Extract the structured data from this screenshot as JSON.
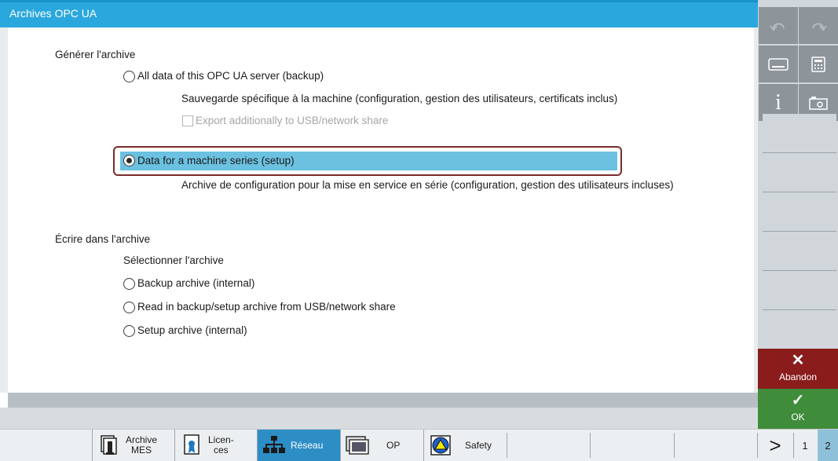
{
  "window": {
    "title": "Archives OPC UA"
  },
  "generate": {
    "heading": "Générer l'archive",
    "option_backup": {
      "label": "All data of this OPC UA server (backup)",
      "description": "Sauvegarde spécifique à la machine (configuration, gestion des utilisateurs, certificats inclus)",
      "selected": false
    },
    "export_checkbox": {
      "label": "Export additionally to USB/network share",
      "checked": false,
      "enabled": false
    },
    "option_setup": {
      "label": "Data for a machine series (setup)",
      "description": "Archive de configuration pour la mise en service en série (configuration, gestion des utilisateurs incluses)",
      "selected": true
    }
  },
  "write": {
    "heading": "Écrire dans l'archive",
    "subheading": "Sélectionner l'archive",
    "options": [
      {
        "label": "Backup archive (internal)",
        "selected": false
      },
      {
        "label": "Read in backup/setup archive from USB/network share",
        "selected": false
      },
      {
        "label": "Setup archive (internal)",
        "selected": false
      }
    ]
  },
  "right_panel": {
    "icons": [
      "undo-icon",
      "redo-icon",
      "keyboard-icon",
      "calculator-icon",
      "info-icon",
      "screenshot-icon"
    ],
    "cancel_label": "Abandon",
    "ok_label": "OK"
  },
  "bottom_bar": {
    "tabs": [
      {
        "label": "Archive\nMES",
        "icon": "archive-icon",
        "active": false
      },
      {
        "label": "Licen-\nces",
        "icon": "license-icon",
        "active": false
      },
      {
        "label": "Réseau",
        "icon": "network-icon",
        "active": true
      },
      {
        "label": "OP",
        "icon": "op-screen-icon",
        "active": false
      },
      {
        "label": "Safety",
        "icon": "safety-icon",
        "active": false
      }
    ],
    "next_label": ">",
    "pages": [
      "1",
      "2"
    ],
    "current_page": "2"
  },
  "colors": {
    "title_bar": "#2aa7dd",
    "selection": "#6cc1e0",
    "selection_frame": "#7a2b2b",
    "cancel": "#8a1c1c",
    "ok": "#3f8c3a",
    "active_tab": "#2d8ec6"
  }
}
